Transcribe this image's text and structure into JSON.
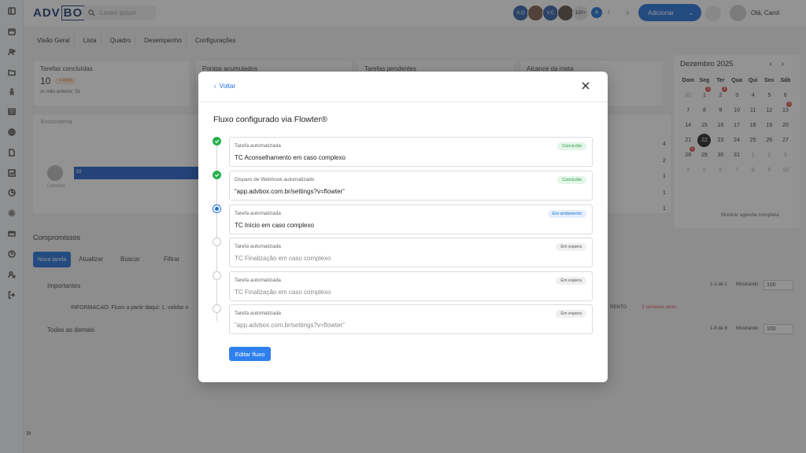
{
  "app": {
    "logo_a": "ADV",
    "logo_b": "BOX"
  },
  "search": {
    "placeholder": "Lorem ipsum"
  },
  "topbar": {
    "avatars": [
      "A.O",
      "",
      "V.C",
      ""
    ],
    "more_count": "100+",
    "add_button": "Adicionar",
    "user_name": "Olá, Carol"
  },
  "tabs": [
    "Visão Geral",
    "Lista",
    "Quadro",
    "Desempenho",
    "Configurações"
  ],
  "cards": [
    {
      "label": "Tarefas concluídas",
      "value": "10",
      "badge": "+ 40%",
      "sub": "vs mês anterior: 91"
    },
    {
      "label": "Pontos acumulados"
    },
    {
      "label": "Tarefas pendentes"
    },
    {
      "label": "Alcance da meta"
    }
  ],
  "chart": {
    "label": "Ecossistema",
    "bar_value": "55",
    "person": "Carolina",
    "right_values": [
      "4",
      "2",
      "1",
      "1",
      "1"
    ]
  },
  "compromissos": {
    "title": "Compromissos",
    "new_task": "Nova tarefa",
    "refresh": "Atualizar",
    "search": "Buscar",
    "filter": "Filtrar",
    "importantes": "Importantes",
    "importantes_count": "1-1 de 1",
    "mostrando": "Mostrando",
    "page_size": "100",
    "row_text": "INFORMACAO: Fluxo a partir daqui: 1. validar o",
    "row_tag": "RENTO",
    "row_when": "3 semanas atrás",
    "todas": "Todas as demais",
    "todas_count": "1-8 de 8"
  },
  "calendar": {
    "month": "Dezembro 2025",
    "weekdays": [
      "Dom",
      "Seg",
      "Ter",
      "Qua",
      "Qui",
      "Sex",
      "Sáb"
    ],
    "days": [
      [
        "30",
        "1",
        "2",
        "3",
        "4",
        "5",
        "6"
      ],
      [
        "7",
        "8",
        "9",
        "10",
        "11",
        "12",
        "13"
      ],
      [
        "14",
        "15",
        "16",
        "17",
        "18",
        "19",
        "20"
      ],
      [
        "21",
        "22",
        "23",
        "24",
        "25",
        "26",
        "27"
      ],
      [
        "28",
        "29",
        "30",
        "31",
        "1",
        "2",
        "3"
      ],
      [
        "4",
        "5",
        "6",
        "7",
        "8",
        "9",
        "10"
      ]
    ],
    "today": "22",
    "event_dots": {
      "1": "1",
      "2": "1",
      "13": "1",
      "28": "1"
    },
    "link": "Mostrar agenda completa"
  },
  "modal": {
    "back": "Voltar",
    "title": "Fluxo configurado via Flowter®",
    "steps": [
      {
        "type": "Tarefa automatizada",
        "name": "TC Aconselhamento em caso complexo",
        "status": "Concluído",
        "state": "done"
      },
      {
        "type": "Disparo de Webhook automatizado",
        "name": "“app.advbox.com.br/settings?v=flowter”",
        "status": "Concluído",
        "state": "done"
      },
      {
        "type": "Tarefa automatizada",
        "name": "TC Início em caso complexo",
        "status": "Em andamento",
        "state": "cur"
      },
      {
        "type": "Tarefa automatizada",
        "name": "TC Finalização em caso complexo",
        "status": "Em espera",
        "state": "wait"
      },
      {
        "type": "Tarefa automatizada",
        "name": "TC Finalização em caso complexo",
        "status": "Em espera",
        "state": "wait"
      },
      {
        "type": "Tarefa automatizada",
        "name": "“app.advbox.com.br/settings?v=flowter”",
        "status": "Em espera",
        "state": "wait"
      }
    ],
    "edit_button": "Editar fluxo"
  },
  "colors": {
    "primary": "#1f6fd6",
    "success": "#27b04d",
    "overlay": "rgba(40,40,40,0.5)"
  }
}
